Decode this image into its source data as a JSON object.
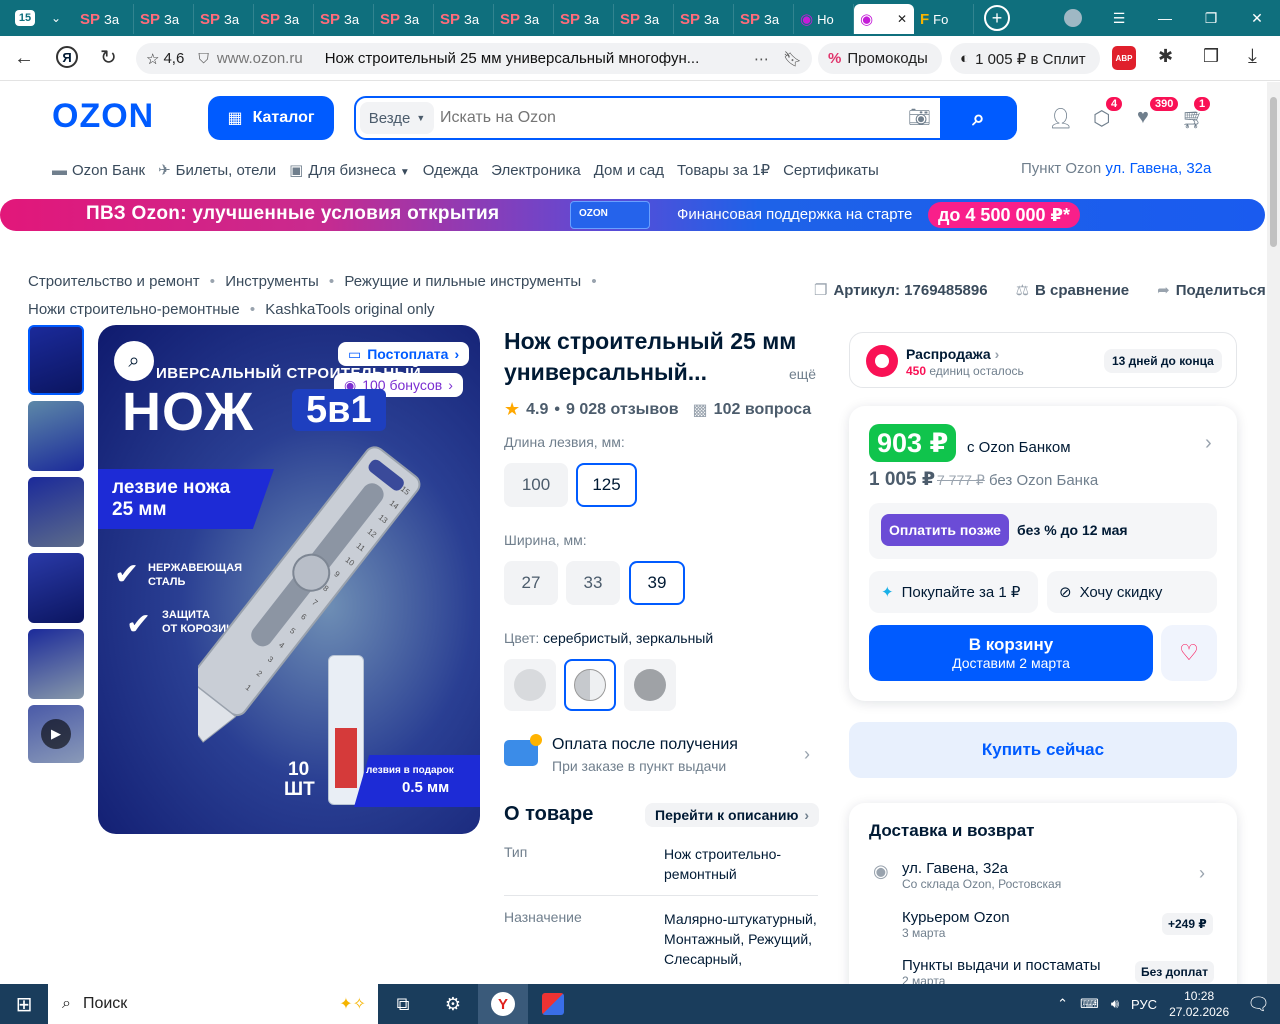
{
  "browser": {
    "tab_count": "15",
    "tabs": [
      {
        "label": "За"
      },
      {
        "label": "За"
      },
      {
        "label": "За"
      },
      {
        "label": "За"
      },
      {
        "label": "За"
      },
      {
        "label": "За"
      },
      {
        "label": "За"
      },
      {
        "label": "За"
      },
      {
        "label": "За"
      },
      {
        "label": "За"
      },
      {
        "label": "За"
      },
      {
        "label": "За"
      },
      {
        "label": "Но"
      },
      {
        "label": ""
      },
      {
        "label": "Fo"
      }
    ],
    "rating": "4,6",
    "domain": "www.ozon.ru",
    "page_title": "Нож строительный 25 мм универсальный многофун...",
    "promo_label": "Промокоды",
    "split_label": "1 005 ₽ в Сплит",
    "abp_label": "ABP"
  },
  "header": {
    "logo": "OZON",
    "catalog_label": "Каталог",
    "search_scope": "Везде",
    "search_placeholder": "Искать на Ozon",
    "badge_orders": "4",
    "badge_favorites": "390",
    "badge_cart": "1"
  },
  "nav": {
    "items": [
      "Ozon Банк",
      "Билеты, отели",
      "Для бизнеса",
      "Одежда",
      "Электроника",
      "Дом и сад",
      "Товары за 1₽",
      "Сертификаты"
    ],
    "pickup_label": "Пункт Ozon",
    "pickup_address": "ул. Гавена, 32а"
  },
  "banner": {
    "left_text": "ПВЗ Ozon: улучшенные условия открытия",
    "logo_text": "OZON",
    "mid_text": "Финансовая поддержка на старте",
    "cta": "до 4 500 000 ₽*"
  },
  "breadcrumbs": [
    "Строительство и ремонт",
    "Инструменты",
    "Режущие и пильные инструменты",
    "Ножи строительно-ремонтные",
    "KashkaTools original only"
  ],
  "actions": {
    "article": "Артикул: 1769485896",
    "compare": "В сравнение",
    "share": "Поделиться"
  },
  "gallery": {
    "postpay_badge": "Постоплата",
    "bonus_badge": "100 бонусов",
    "headline_top": "ИВЕРСАЛЬНЫЙ СТРОИТЕЛЬНЫЙ",
    "headline_big": "НОЖ",
    "headline_box": "5в1",
    "blade_text_1": "лезвие ножа",
    "blade_text_2": "25 мм",
    "check_1a": "НЕРЖАВЕЮЩАЯ",
    "check_1b": "СТАЛЬ",
    "check_2a": "ЗАЩИТА",
    "check_2b": "ОТ КОРОЗИИ",
    "count_1": "10",
    "count_2": "ШТ",
    "gift_1": "лезвия в подарок",
    "gift_2": "0.5 мм",
    "ruler_ticks": [
      "15",
      "14",
      "13",
      "12",
      "11",
      "10",
      "9",
      "8",
      "7",
      "6",
      "5",
      "4",
      "3",
      "2",
      "1"
    ]
  },
  "product": {
    "title_1": "Нож строительный 25 мм",
    "title_2": "универсальный...",
    "more": "ещё",
    "rating": "4.9",
    "reviews": "9 028 отзывов",
    "questions": "102 вопроса",
    "length_label": "Длина лезвия, мм:",
    "lengths": [
      "100",
      "125"
    ],
    "width_label": "Ширина, мм:",
    "widths": [
      "27",
      "33",
      "39"
    ],
    "color_label": "Цвет:",
    "color_value": "серебристый, зеркальный",
    "payment_title": "Оплата после получения",
    "payment_sub": "При заказе в пункт выдачи",
    "about_title": "О товаре",
    "about_link": "Перейти к описанию",
    "specs": [
      {
        "k": "Тип",
        "v": "Нож строительно-ремонтный"
      },
      {
        "k": "Назначение",
        "v": "Малярно-штукатурный, Монтажный, Режущий, Слесарный,"
      }
    ]
  },
  "sale": {
    "title": "Распродажа",
    "count": "450",
    "count_suffix": "единиц осталось",
    "days": "13 дней до конца"
  },
  "price": {
    "bank_price": "903 ₽",
    "bank_label": "с Ozon Банком",
    "regular": "1 005 ₽",
    "old": "7 777 ₽",
    "regular_label": "без Ozon Банка",
    "paylater_btn": "Оплатить позже",
    "paylater_text": "без % до 12 мая",
    "buy1_label": "Покупайте за 1 ₽",
    "discount_label": "Хочу скидку",
    "cart_label": "В корзину",
    "cart_sub": "Доставим 2 марта",
    "buy_now": "Купить сейчас"
  },
  "delivery": {
    "title": "Доставка и возврат",
    "rows": [
      {
        "title": "ул. Гавена, 32а",
        "sub": "Со склада Ozon, Ростовская",
        "tag": ""
      },
      {
        "title": "Курьером Ozon",
        "sub": "3 марта",
        "tag": "+249 ₽"
      },
      {
        "title": "Пункты выдачи и постаматы",
        "sub": "2 марта",
        "tag": "Без доплат"
      }
    ]
  },
  "taskbar": {
    "search": "Поиск",
    "lang": "РУС",
    "time": "10:28",
    "date": "27.02.2026"
  }
}
